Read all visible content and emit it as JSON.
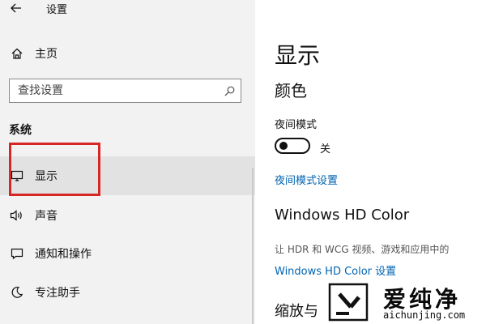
{
  "window": {
    "title": "设置"
  },
  "sidebar": {
    "home_label": "主页",
    "search_placeholder": "查找设置",
    "section_header": "系统",
    "items": [
      {
        "label": "显示",
        "icon": "monitor-icon",
        "selected": true
      },
      {
        "label": "声音",
        "icon": "speaker-icon"
      },
      {
        "label": "通知和操作",
        "icon": "notification-icon"
      },
      {
        "label": "专注助手",
        "icon": "moon-icon"
      }
    ]
  },
  "main": {
    "page_title": "显示",
    "color_section": "颜色",
    "night_light_label": "夜间模式",
    "toggle_state": "关",
    "night_light_link": "夜间模式设置",
    "hd_color_title": "Windows HD Color",
    "hd_color_desc": "让 HDR 和 WCG 视频、游戏和应用中的",
    "hd_color_link": "Windows HD Color 设置",
    "scale_title": "缩放与"
  },
  "watermark": {
    "text": "爱纯净",
    "url": "aichunjing.com"
  },
  "colors": {
    "link": "#0063b1",
    "highlight": "#d62626",
    "sidebar_bg": "#f2f2f2",
    "selected_bg": "#e2e2e2"
  }
}
